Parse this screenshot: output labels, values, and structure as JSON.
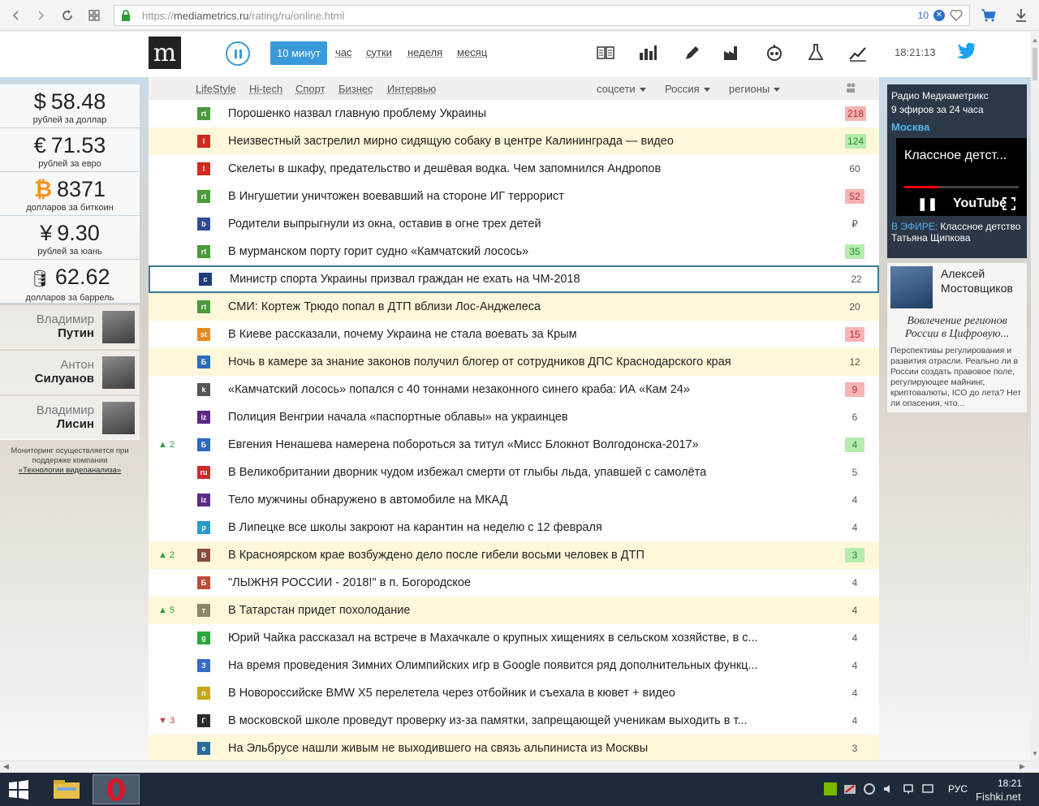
{
  "browser": {
    "url_scheme": "https://",
    "url_host": "mediametrics.ru",
    "url_path": "/rating/ru/online.html",
    "tab_count": "10"
  },
  "header": {
    "logo": "m",
    "periods": [
      "10 минут",
      "час",
      "сутки",
      "неделя",
      "месяц"
    ],
    "active_period": "10 минут",
    "time": "18:21:13",
    "icons": [
      "columns-icon",
      "bar-chart-icon",
      "pen-icon",
      "factory-icon",
      "mediametrics-radio-icon",
      "flask-icon",
      "trend-chart-icon"
    ]
  },
  "filters": {
    "categories": [
      "LifeStyle",
      "Hi-tech",
      "Спорт",
      "Бизнес",
      "Интервью"
    ],
    "dropdowns": [
      "соцсети",
      "Россия",
      "регионы"
    ]
  },
  "rates": [
    {
      "symbol": "$",
      "value": "58.48",
      "label": "рублей за доллар"
    },
    {
      "symbol": "€",
      "value": "71.53",
      "label": "рублей за евро"
    },
    {
      "symbol": "₿",
      "value": "8371",
      "label": "долларов за биткоин"
    },
    {
      "symbol": "¥",
      "value": "9.30",
      "label": "рублей за юань"
    },
    {
      "symbol": "🛢",
      "value": "62.62",
      "label": "долларов за баррель"
    }
  ],
  "persons": [
    {
      "first": "Владимир",
      "last": "Путин"
    },
    {
      "first": "Антон",
      "last": "Силуанов"
    },
    {
      "first": "Владимир",
      "last": "Лисин"
    }
  ],
  "monitor_note": {
    "text": "Мониторинг осуществляется при поддержке компании",
    "link": "«Технологии видеоанализа»"
  },
  "news": [
    {
      "title": "Порошенко назвал главную проблему Украины",
      "count": "218",
      "count_style": "red",
      "trend": "",
      "trend_dir": "",
      "hl": false,
      "src": "rt",
      "color": "#4a9b3a"
    },
    {
      "title": "Неизвестный застрелил мирно сидящую собаку в центре Калининграда — видео",
      "count": "124",
      "count_style": "green",
      "trend": "",
      "trend_dir": "",
      "hl": true,
      "src": "l",
      "color": "#d22a1f"
    },
    {
      "title": "Скелеты в шкафу, предательство и дешёвая водка. Чем запомнился Андропов",
      "count": "60",
      "count_style": "plain",
      "trend": "",
      "trend_dir": "",
      "hl": false,
      "src": "l",
      "color": "#d22a1f"
    },
    {
      "title": "В Ингушетии уничтожен воевавший на стороне ИГ террорист",
      "count": "52",
      "count_style": "red",
      "trend": "",
      "trend_dir": "",
      "hl": false,
      "src": "rt",
      "color": "#4a9b3a"
    },
    {
      "title": "Родители выпрыгнули из окна, оставив в огне трех детей",
      "count": "₽",
      "count_style": "plain",
      "trend": "",
      "trend_dir": "",
      "hl": false,
      "src": "b",
      "color": "#2f4c9a"
    },
    {
      "title": "В мурманском порту горит судно «Камчатский лосось»",
      "count": "35",
      "count_style": "green",
      "trend": "",
      "trend_dir": "",
      "hl": false,
      "src": "rt",
      "color": "#4a9b3a"
    },
    {
      "title": "Министр спорта Украины призвал граждан не ехать на ЧМ-2018",
      "count": "22",
      "count_style": "plain",
      "trend": "",
      "trend_dir": "",
      "hl": false,
      "sel": true,
      "src": "c",
      "color": "#1d3d7a"
    },
    {
      "title": "СМИ: Кортеж Трюдо попал в ДТП вблизи Лос-Анджелеса",
      "count": "20",
      "count_style": "plain",
      "trend": "",
      "trend_dir": "",
      "hl": true,
      "src": "rt",
      "color": "#4a9b3a"
    },
    {
      "title": "В Киеве рассказали, почему Украина не стала воевать за Крым",
      "count": "15",
      "count_style": "red",
      "trend": "",
      "trend_dir": "",
      "hl": false,
      "src": "st",
      "color": "#e88a1f"
    },
    {
      "title": "Ночь в камере за знание законов получил блогер от сотрудников ДПС Краснодарского края",
      "count": "12",
      "count_style": "plain",
      "trend": "",
      "trend_dir": "",
      "hl": true,
      "src": "Б",
      "color": "#2a6ac0"
    },
    {
      "title": "«Камчатский лосось» попался с 40 тоннами незаконного синего краба: ИА «Кам 24»",
      "count": "9",
      "count_style": "red",
      "trend": "",
      "trend_dir": "",
      "hl": false,
      "src": "k",
      "color": "#555555"
    },
    {
      "title": "Полиция Венгрии начала «паспортные облавы» на украинцев",
      "count": "6",
      "count_style": "plain",
      "trend": "",
      "trend_dir": "",
      "hl": false,
      "src": "iz",
      "color": "#5b2a86"
    },
    {
      "title": "Евгения Ненашева намерена побороться за титул «Мисс Блокнот Волгодонска-2017»",
      "count": "4",
      "count_style": "green",
      "trend": "2",
      "trend_dir": "up",
      "hl": false,
      "src": "Б",
      "color": "#2a6ac0"
    },
    {
      "title": "В Великобритании дворник чудом избежал смерти от глыбы льда, упавшей с самолёта",
      "count": "5",
      "count_style": "plain",
      "trend": "",
      "trend_dir": "",
      "hl": false,
      "src": "ru",
      "color": "#cc2b2b"
    },
    {
      "title": "Тело мужчины обнаружено в автомобиле на МКАД",
      "count": "4",
      "count_style": "plain",
      "trend": "",
      "trend_dir": "",
      "hl": false,
      "src": "iz",
      "color": "#5b2a86"
    },
    {
      "title": "В Липецке все школы закроют на карантин на неделю с 12 февраля",
      "count": "4",
      "count_style": "plain",
      "trend": "",
      "trend_dir": "",
      "hl": false,
      "src": "p",
      "color": "#2a9ad0"
    },
    {
      "title": "В Красноярском крае возбуждено дело после гибели восьми человек в ДТП",
      "count": "3",
      "count_style": "green",
      "trend": "2",
      "trend_dir": "up",
      "hl": true,
      "src": "В",
      "color": "#8a4a3a"
    },
    {
      "title": "\"ЛЫЖНЯ РОССИИ - 2018!\" в п. Богородское",
      "count": "4",
      "count_style": "plain",
      "trend": "",
      "trend_dir": "",
      "hl": false,
      "src": "Б",
      "color": "#c04a3a"
    },
    {
      "title": "В Татарстан придет похолодание",
      "count": "4",
      "count_style": "plain",
      "trend": "5",
      "trend_dir": "up",
      "hl": true,
      "src": "т",
      "color": "#888866"
    },
    {
      "title": "Юрий Чайка рассказал на встрече в Махачкале о крупных хищениях в сельском хозяйстве, в с...",
      "count": "4",
      "count_style": "plain",
      "trend": "",
      "trend_dir": "",
      "hl": false,
      "src": "g",
      "color": "#2aa83a"
    },
    {
      "title": "На время проведения Зимних Олимпийских игр в Google появится ряд дополнительных функц...",
      "count": "4",
      "count_style": "plain",
      "trend": "",
      "trend_dir": "",
      "hl": false,
      "src": "3",
      "color": "#3a6ac8"
    },
    {
      "title": "В Новороссийске BMW X5 перелетела через отбойник и съехала в кювет + видео",
      "count": "4",
      "count_style": "plain",
      "trend": "",
      "trend_dir": "",
      "hl": false,
      "src": "n",
      "color": "#c8a81a"
    },
    {
      "title": "В московской школе проведут проверку из-за памятки, запрещающей ученикам выходить в т...",
      "count": "4",
      "count_style": "plain",
      "trend": "3",
      "trend_dir": "down",
      "hl": false,
      "src": "Г",
      "color": "#2b2b2b"
    },
    {
      "title": "На Эльбрусе нашли живым не выходившего на связь альпиниста из Москвы",
      "count": "3",
      "count_style": "plain",
      "trend": "",
      "trend_dir": "",
      "hl": true,
      "src": "e",
      "color": "#2a6a9a"
    }
  ],
  "radio": {
    "title": "Радио Медиаметрикс",
    "subtitle": "9 эфиров за 24 часа",
    "city": "Москва",
    "video_title": "Классное детст...",
    "video_brand": "YouTube",
    "onair_label": "В ЭФИРЕ:",
    "onair_show": "Классное детство",
    "onair_host": "Татьяна Щипкова"
  },
  "author": {
    "name": "Алексей Мостовщиков",
    "headline": "Вовлечение регионов России в Цифровую...",
    "lead": "Перспективы регулирования и развития отрасли. Реально ли в России создать правовое поле, регулирующее майнинг, криптовалюты, ICO до лета? Нет ли опасения, что..."
  },
  "taskbar": {
    "lang": "РУС",
    "time": "18:21",
    "watermark": "Fishki.net"
  }
}
